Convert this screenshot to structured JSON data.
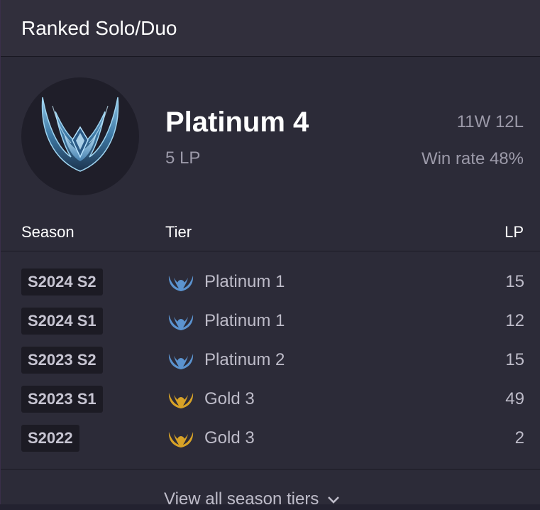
{
  "header": {
    "title": "Ranked Solo/Duo"
  },
  "current": {
    "rank": "Platinum 4",
    "lp": "5 LP",
    "record": "11W 12L",
    "win_rate": "Win rate 48%",
    "emblem_icon": "platinum-emblem"
  },
  "table": {
    "headers": {
      "season": "Season",
      "tier": "Tier",
      "lp": "LP"
    },
    "rows": [
      {
        "season": "S2024 S2",
        "tier": "Platinum 1",
        "lp": "15",
        "icon": "platinum-tier-icon",
        "color": "#5b93cf"
      },
      {
        "season": "S2024 S1",
        "tier": "Platinum 1",
        "lp": "12",
        "icon": "platinum-tier-icon",
        "color": "#5b93cf"
      },
      {
        "season": "S2023 S2",
        "tier": "Platinum 2",
        "lp": "15",
        "icon": "platinum-tier-icon",
        "color": "#5b93cf"
      },
      {
        "season": "S2023 S1",
        "tier": "Gold 3",
        "lp": "49",
        "icon": "gold-tier-icon",
        "color": "#d7a227"
      },
      {
        "season": "S2022",
        "tier": "Gold 3",
        "lp": "2",
        "icon": "gold-tier-icon",
        "color": "#d7a227"
      }
    ]
  },
  "footer": {
    "link_label": "View all season tiers",
    "chevron_icon": "chevron-down-icon"
  }
}
